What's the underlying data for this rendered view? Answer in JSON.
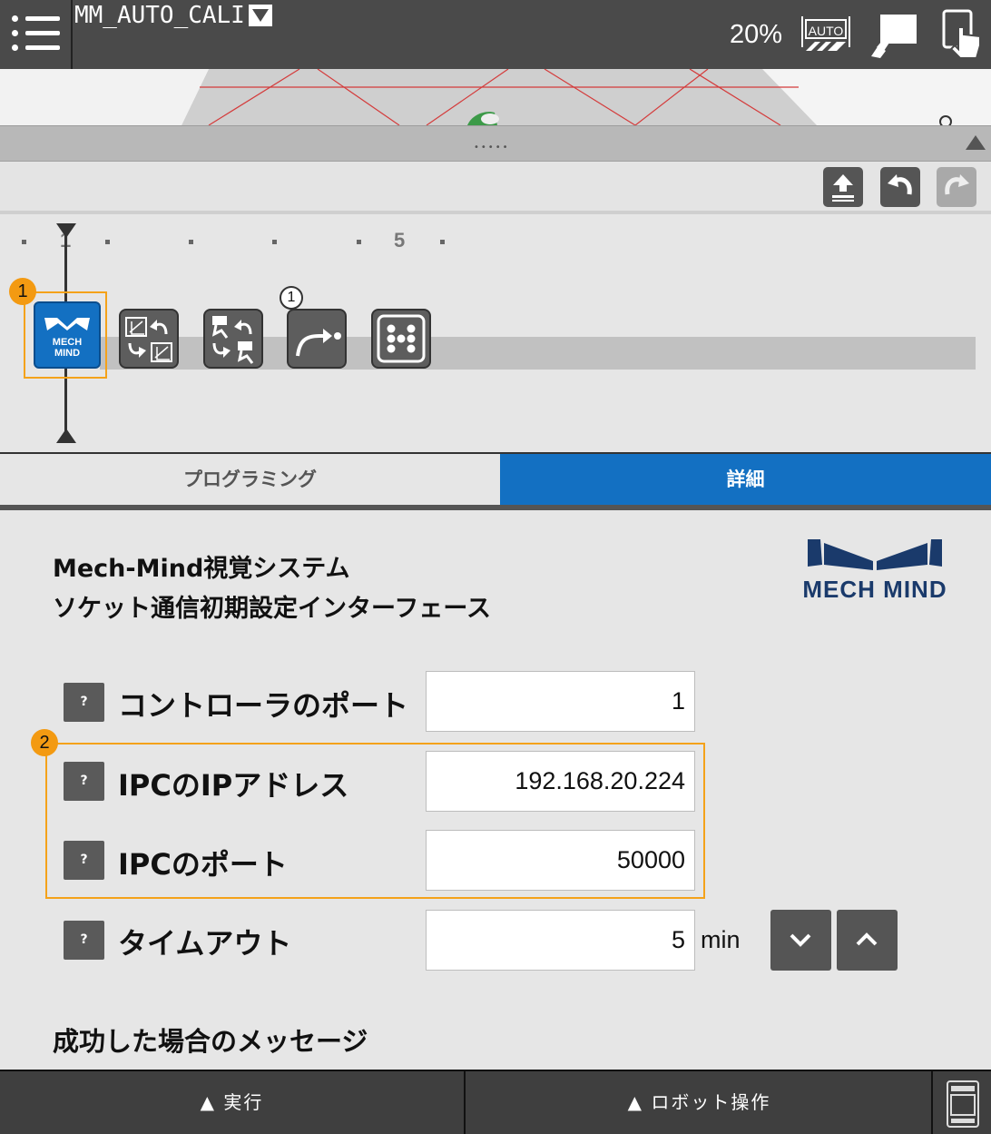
{
  "header": {
    "program_name": "MM_AUTO_CALI",
    "speed": "20%",
    "auto_icon_label": "AUTO",
    "icons": [
      "menu-icon",
      "dropdown-arrow-icon",
      "auto-mode-icon",
      "teach-pendant-icon",
      "touch-icon"
    ]
  },
  "view3d": {
    "handle_dots": "•••••"
  },
  "toolbar": {
    "icons": [
      "upload-icon",
      "undo-icon",
      "redo-icon"
    ],
    "redo_enabled": false
  },
  "timeline": {
    "ruler_labels": {
      "first": "1",
      "fifth": "5"
    },
    "nodes": [
      {
        "name": "mech-mind",
        "label_line1": "MECH",
        "label_line2": "MIND",
        "selected": true
      },
      {
        "name": "calibration-1-icon"
      },
      {
        "name": "calibration-2-icon"
      },
      {
        "name": "move-path-icon",
        "badge": "1"
      },
      {
        "name": "grid-dots-icon"
      }
    ],
    "callout_1": "1"
  },
  "tabs": {
    "programming": "プログラミング",
    "detail": "詳細",
    "active": "detail"
  },
  "panel": {
    "title_line1": "Mech-Mind視覚システム",
    "title_line2": "ソケット通信初期設定インターフェース",
    "logo_text": "MECH MIND",
    "help_label": "?",
    "callout_2": "2",
    "fields": {
      "controller_port": {
        "label": "コントローラのポート",
        "value": "1"
      },
      "ipc_ip": {
        "label": "IPCのIPアドレス",
        "value": "192.168.20.224"
      },
      "ipc_port": {
        "label": "IPCのポート",
        "value": "50000"
      },
      "timeout": {
        "label": "タイムアウト",
        "value": "5",
        "unit": "min"
      }
    },
    "success_message_heading": "成功した場合のメッセージ"
  },
  "bottombar": {
    "run": "▲ 実行",
    "robot": "▲ ロボット操作"
  },
  "colors": {
    "topbar": "#4a4a4a",
    "accent_blue": "#1370c2",
    "highlight_orange": "#f39a12"
  }
}
